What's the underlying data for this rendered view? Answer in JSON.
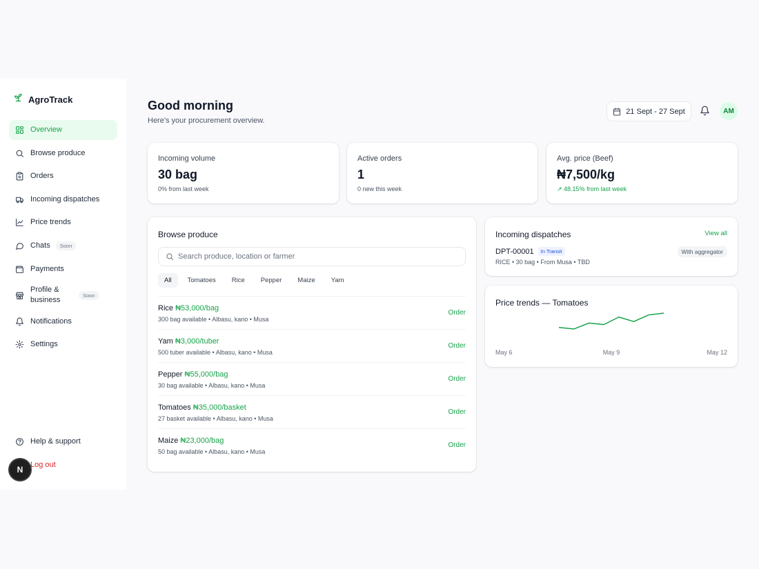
{
  "brand": {
    "name": "AgroTrack",
    "color": "#16a34a"
  },
  "sidebar": {
    "items": [
      {
        "label": "Overview",
        "icon": "grid-icon",
        "active": true
      },
      {
        "label": "Browse produce",
        "icon": "search-icon"
      },
      {
        "label": "Orders",
        "icon": "clipboard-icon"
      },
      {
        "label": "Incoming dispatches",
        "icon": "truck-icon"
      },
      {
        "label": "Price trends",
        "icon": "line-chart-icon"
      },
      {
        "label": "Chats",
        "icon": "chat-icon",
        "badge": "Soon"
      },
      {
        "label": "Payments",
        "icon": "wallet-icon"
      },
      {
        "label": "Profile & business",
        "icon": "store-icon",
        "badge": "Soon"
      },
      {
        "label": "Notifications",
        "icon": "bell-icon"
      },
      {
        "label": "Settings",
        "icon": "gear-icon"
      }
    ],
    "bottom": [
      {
        "label": "Help & support",
        "icon": "help-icon"
      },
      {
        "label": "Log out",
        "icon": "logout-icon"
      }
    ],
    "dev_badge": "N"
  },
  "header": {
    "greeting": "Good morning",
    "subtitle": "Here's your procurement overview.",
    "date_range": "21 Sept - 27 Sept",
    "avatar_initials": "AM"
  },
  "stats": [
    {
      "label": "Incoming volume",
      "value": "30 bag",
      "note": "0% from last week"
    },
    {
      "label": "Active orders",
      "value": "1",
      "note": "0 new this week"
    },
    {
      "label": "Avg. price (Beef)",
      "value": "₦7,500/kg",
      "note": "↗ 48.15% from last week"
    }
  ],
  "browse": {
    "title": "Browse produce",
    "search_placeholder": "Search produce, location or farmer",
    "filters": [
      "All",
      "Tomatoes",
      "Rice",
      "Pepper",
      "Maize",
      "Yam"
    ],
    "active_filter": "All",
    "items": [
      {
        "name": "Rice",
        "price": "₦53,000/bag",
        "meta": "300 bag available • Albasu, kano • Musa",
        "action": "Order"
      },
      {
        "name": "Yam",
        "price": "₦3,000/tuber",
        "meta": "500 tuber available • Albasu, kano • Musa",
        "action": "Order"
      },
      {
        "name": "Pepper",
        "price": "₦55,000/bag",
        "meta": "30 bag available • Albasu, kano • Musa",
        "action": "Order"
      },
      {
        "name": "Tomatoes",
        "price": "₦35,000/basket",
        "meta": "27 basket available • Albasu, kano • Musa",
        "action": "Order"
      },
      {
        "name": "Maize",
        "price": "₦23,000/bag",
        "meta": "50 bag available • Albasu, kano • Musa",
        "action": "Order"
      }
    ]
  },
  "dispatches": {
    "title": "Incoming dispatches",
    "view_all": "View all",
    "item": {
      "id": "DPT-00001",
      "status": "In Transit",
      "meta": "RICE • 30 bag • From Musa • TBD",
      "holder": "With aggregator"
    }
  },
  "chart_data": {
    "type": "line",
    "title": "Price trends — Tomatoes",
    "x_tick_labels": [
      "May 6",
      "May 9",
      "May 12"
    ],
    "series": [
      {
        "values": [
          0.35,
          0.28,
          0.55,
          0.48,
          0.82,
          0.62,
          0.92,
          1.0
        ]
      }
    ],
    "color": "#16a34a",
    "grid": false
  }
}
